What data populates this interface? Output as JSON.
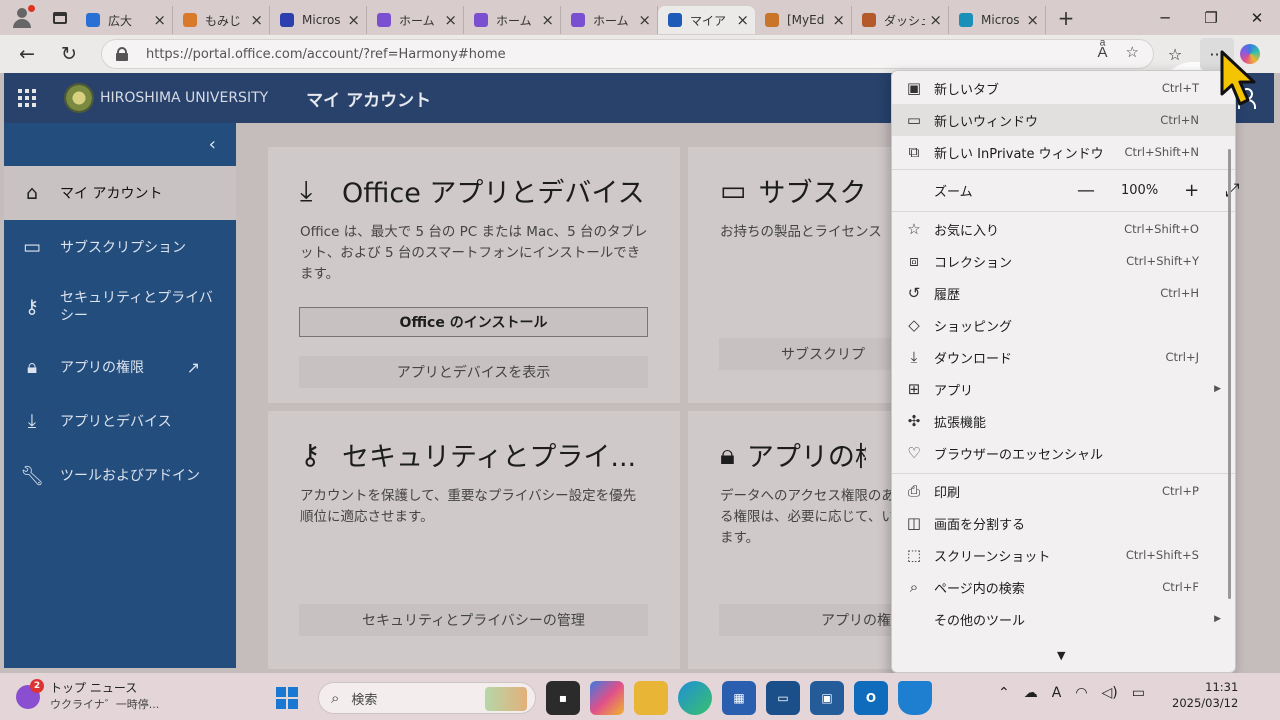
{
  "browser": {
    "tabs": [
      {
        "title": "広大",
        "icon": "search-icon",
        "color": "#2a6fd6"
      },
      {
        "title": "もみじ",
        "icon": "momiji-icon",
        "color": "#d97a2a"
      },
      {
        "title": "Micros",
        "icon": "microsoft-icon",
        "color": "#2b3fb0"
      },
      {
        "title": "ホーム |",
        "icon": "copilot-icon",
        "color": "#7a4fd0"
      },
      {
        "title": "ホーム |",
        "icon": "copilot-icon",
        "color": "#7a4fd0"
      },
      {
        "title": "ホーム |",
        "icon": "copilot-icon",
        "color": "#7a4fd0"
      },
      {
        "title": "マイア",
        "icon": "office-icon",
        "color": "#1e5bb8"
      },
      {
        "title": "[MyEd",
        "icon": "momiji-icon",
        "color": "#c8752a"
      },
      {
        "title": "ダッシュ",
        "icon": "dashboard-icon",
        "color": "#b45a2a"
      },
      {
        "title": "Micros",
        "icon": "edge-icon",
        "color": "#1a8fb8"
      }
    ],
    "active_tab_index": 6,
    "url": "https://portal.office.com/account/?ref=Harmony#home"
  },
  "page": {
    "org_name": "HIROSHIMA UNIVERSITY",
    "app_title": "マイ アカウント",
    "sidebar": [
      {
        "label": "マイ アカウント",
        "icon": "home-icon",
        "selected": true
      },
      {
        "label": "サブスクリプション",
        "icon": "card-icon"
      },
      {
        "label": "セキュリティとプライバシー",
        "icon": "key-icon"
      },
      {
        "label": "アプリの権限",
        "icon": "lock-icon",
        "external": true
      },
      {
        "label": "アプリとデバイス",
        "icon": "download-icon"
      },
      {
        "label": "ツールおよびアドイン",
        "icon": "wrench-icon"
      }
    ],
    "cards": {
      "office": {
        "title": "Office アプリとデバイス",
        "desc": "Office は、最大で 5 台の PC または Mac、5 台のタブレット、および 5 台のスマートフォンにインストールできます。",
        "primary_button": "Office のインストール",
        "secondary_button": "アプリとデバイスを表示"
      },
      "subscription": {
        "title": "サブスクリ",
        "desc": "お持ちの製品とライセンス",
        "button": "サブスクリプ"
      },
      "security": {
        "title": "セキュリティとプライ...",
        "desc": "アカウントを保護して、重要なプライバシー設定を優先順位に適応させます。",
        "button": "セキュリティとプライバシーの管理"
      },
      "apps": {
        "title": "アプリの権",
        "desc": "データへのアクセス権限のある権限は、必要に応じて、います。",
        "button": "アプリの権"
      }
    }
  },
  "menu": {
    "items": [
      {
        "label": "新しいタブ",
        "shortcut": "Ctrl+T",
        "icon": "new-tab-icon"
      },
      {
        "label": "新しいウィンドウ",
        "shortcut": "Ctrl+N",
        "icon": "new-window-icon",
        "highlight": true
      },
      {
        "label": "新しい InPrivate ウィンドウ",
        "shortcut": "Ctrl+Shift+N",
        "icon": "inprivate-icon"
      },
      {
        "label": "お気に入り",
        "shortcut": "Ctrl+Shift+O",
        "icon": "favorites-icon"
      },
      {
        "label": "コレクション",
        "shortcut": "Ctrl+Shift+Y",
        "icon": "collections-icon"
      },
      {
        "label": "履歴",
        "shortcut": "Ctrl+H",
        "icon": "history-icon"
      },
      {
        "label": "ショッピング",
        "shortcut": "",
        "icon": "shopping-tag-icon"
      },
      {
        "label": "ダウンロード",
        "shortcut": "Ctrl+J",
        "icon": "download-icon"
      },
      {
        "label": "アプリ",
        "shortcut": "",
        "icon": "apps-icon",
        "submenu": true
      },
      {
        "label": "拡張機能",
        "shortcut": "",
        "icon": "extensions-icon"
      },
      {
        "label": "ブラウザーのエッセンシャル",
        "shortcut": "",
        "icon": "essentials-heart-icon"
      },
      {
        "label": "印刷",
        "shortcut": "Ctrl+P",
        "icon": "print-icon"
      },
      {
        "label": "画面を分割する",
        "shortcut": "",
        "icon": "split-screen-icon"
      },
      {
        "label": "スクリーンショット",
        "shortcut": "Ctrl+Shift+S",
        "icon": "screenshot-icon"
      },
      {
        "label": "ページ内の検索",
        "shortcut": "Ctrl+F",
        "icon": "find-icon"
      },
      {
        "label": "その他のツール",
        "shortcut": "",
        "icon": "",
        "submenu": true
      }
    ],
    "zoom": {
      "label": "ズーム",
      "value": "100%",
      "minus": "—",
      "plus": "+"
    }
  },
  "taskbar": {
    "news_title": "トップ ニュース",
    "news_sub": "ウクライナ゛一時停...",
    "news_badge": "2",
    "search_placeholder": "検索",
    "time": "11:31",
    "date": "2025/03/12",
    "ime": "A"
  }
}
